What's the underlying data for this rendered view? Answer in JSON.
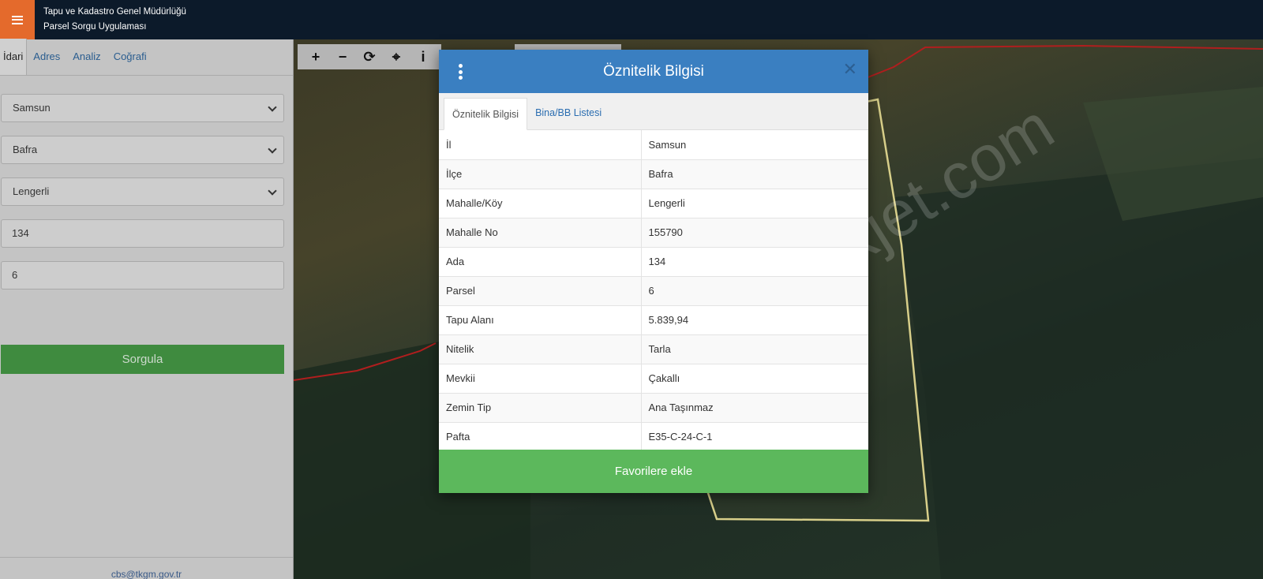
{
  "header": {
    "title_line1": "Tapu ve Kadastro Genel Müdürlüğü",
    "title_line2": "Parsel Sorgu Uygulaması"
  },
  "sidebar": {
    "tabs": [
      {
        "label": "İdari",
        "active": true
      },
      {
        "label": "Adres",
        "active": false
      },
      {
        "label": "Analiz",
        "active": false
      },
      {
        "label": "Coğrafi",
        "active": false
      }
    ],
    "il_select": "Samsun",
    "ilce_select": "Bafra",
    "mahalle_select": "Lengerli",
    "ada_input": "134",
    "parsel_input": "6",
    "query_button": "Sorgula",
    "footer_email": "cbs@tkgm.gov.tr"
  },
  "map": {
    "watermark": "emlakjet.com",
    "tools": [
      "+",
      "−",
      "⟳",
      "⌖",
      "i"
    ]
  },
  "modal": {
    "title": "Öznitelik Bilgisi",
    "close_glyph": "✕",
    "tabs": [
      {
        "label": "Öznitelik Bilgisi",
        "active": true
      },
      {
        "label": "Bina/BB Listesi",
        "active": false
      }
    ],
    "rows": [
      {
        "key": "İl",
        "value": "Samsun"
      },
      {
        "key": "İlçe",
        "value": "Bafra"
      },
      {
        "key": "Mahalle/Köy",
        "value": "Lengerli"
      },
      {
        "key": "Mahalle No",
        "value": "155790"
      },
      {
        "key": "Ada",
        "value": "134"
      },
      {
        "key": "Parsel",
        "value": "6"
      },
      {
        "key": "Tapu Alanı",
        "value": "5.839,94"
      },
      {
        "key": "Nitelik",
        "value": "Tarla"
      },
      {
        "key": "Mevkii",
        "value": "Çakallı"
      },
      {
        "key": "Zemin Tip",
        "value": "Ana Taşınmaz"
      },
      {
        "key": "Pafta",
        "value": "E35-C-24-C-1"
      }
    ],
    "favorite_button": "Favorilere ekle"
  },
  "colors": {
    "header_bg": "#0c1a2a",
    "menu_accent": "#e46a2c",
    "modal_header": "#3a7fc1",
    "favorite_green": "#5cb85c",
    "query_green": "#3f8b3f"
  }
}
